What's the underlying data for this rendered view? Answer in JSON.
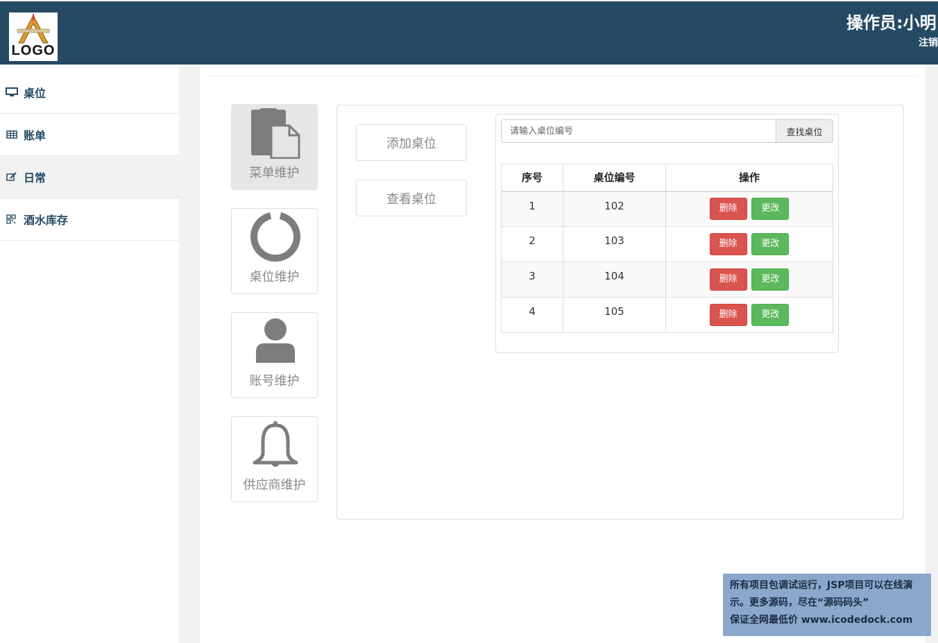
{
  "header": {
    "logo_text": "LOGO",
    "operator": "操作员:小明",
    "logout": "注销",
    "bg_color": "#244a64"
  },
  "sidebar": {
    "items": [
      {
        "label": "桌位",
        "icon": "monitor-icon"
      },
      {
        "label": "账单",
        "icon": "table-icon"
      },
      {
        "label": "日常",
        "icon": "edit-icon",
        "active": true
      },
      {
        "label": "酒水库存",
        "icon": "qrcode-icon"
      }
    ]
  },
  "tiles": [
    {
      "label": "菜单维护",
      "icon": "file-copy-icon",
      "active": true
    },
    {
      "label": "桌位维护",
      "icon": "circle-ring-icon"
    },
    {
      "label": "账号维护",
      "icon": "user-icon"
    },
    {
      "label": "供应商维护",
      "icon": "bell-icon"
    }
  ],
  "actions": {
    "add_table": "添加桌位",
    "view_table": "查看桌位"
  },
  "search": {
    "placeholder": "请输入桌位编号",
    "button": "查找桌位"
  },
  "table": {
    "headers": [
      "序号",
      "桌位编号",
      "操作"
    ],
    "rows": [
      {
        "index": "1",
        "code": "102"
      },
      {
        "index": "2",
        "code": "103"
      },
      {
        "index": "3",
        "code": "104"
      },
      {
        "index": "4",
        "code": "105"
      }
    ],
    "delete_label": "删除",
    "edit_label": "更改"
  },
  "watermark": {
    "line1": "所有项目包调试运行，JSP项目可以在线演",
    "line2": "示。更多源码，尽在“源码码头”",
    "line3": "保证全网最低价 www.icodedock.com"
  }
}
